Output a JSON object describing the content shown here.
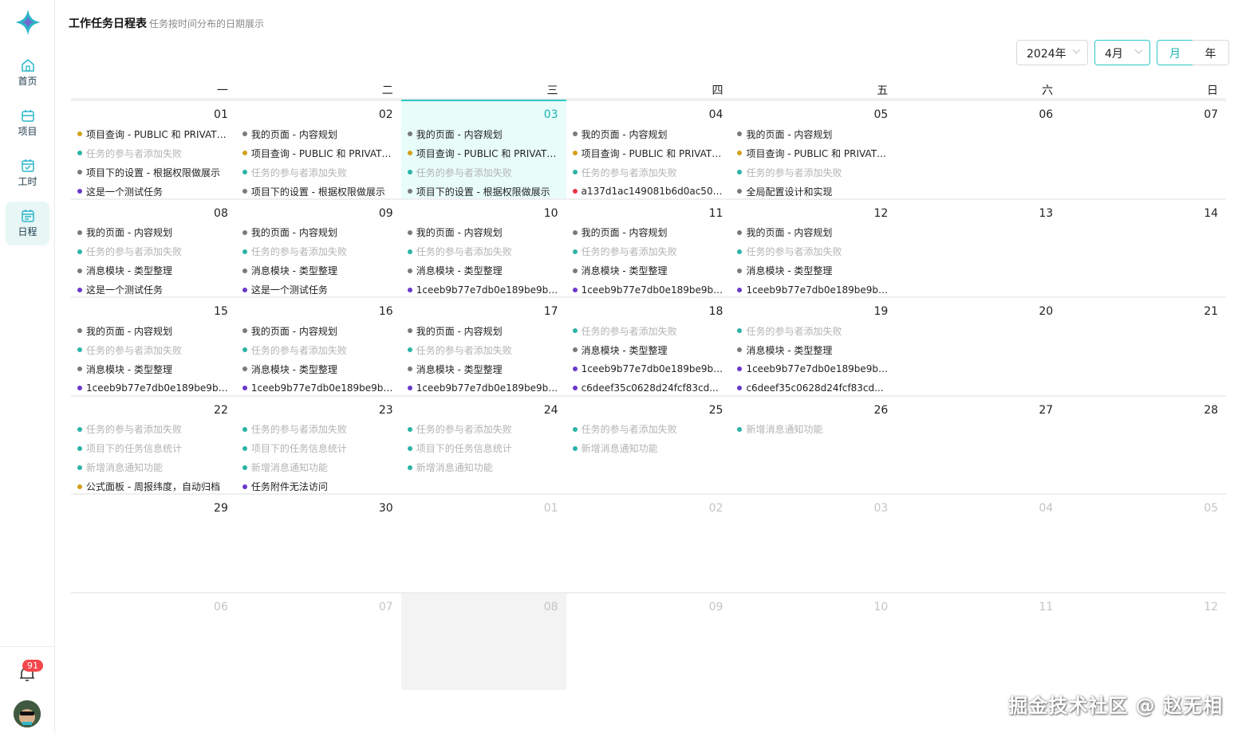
{
  "header": {
    "title": "工作任务日程表",
    "subtitle": "任务按时间分布的日期展示",
    "year": "2024年",
    "month": "4月",
    "view_month": "月",
    "view_year": "年"
  },
  "sidebar": {
    "items": [
      {
        "label": "首页"
      },
      {
        "label": "项目"
      },
      {
        "label": "工时"
      },
      {
        "label": "日程"
      }
    ],
    "notifications": "91"
  },
  "colors": {
    "accent": "#2cc5c5",
    "gray": "#7a7a7a",
    "teal": "#2bb3a8",
    "gold": "#d4a017",
    "purple": "#6a38c9",
    "red": "#e8363f"
  },
  "weekdays": [
    "一",
    "二",
    "三",
    "四",
    "五",
    "六",
    "日"
  ],
  "calendar": {
    "weeks": [
      {
        "days": [
          {
            "date": "01",
            "events": [
              {
                "c": "gold",
                "t": "项目查询 - PUBLIC 和 PRIVATE 项目查询"
              },
              {
                "c": "teal",
                "t": "任务的参与者添加失败",
                "dim": true
              },
              {
                "c": "gray",
                "t": "项目下的设置 - 根据权限做展示"
              },
              {
                "c": "purple",
                "t": "这是一个测试任务"
              }
            ]
          },
          {
            "date": "02",
            "events": [
              {
                "c": "gray",
                "t": "我的页面 - 内容规划"
              },
              {
                "c": "gold",
                "t": "项目查询 - PUBLIC 和 PRIVATE 项目查询"
              },
              {
                "c": "teal",
                "t": "任务的参与者添加失败",
                "dim": true
              },
              {
                "c": "gray",
                "t": "项目下的设置 - 根据权限做展示"
              }
            ]
          },
          {
            "date": "03",
            "today": true,
            "events": [
              {
                "c": "gray",
                "t": "我的页面 - 内容规划"
              },
              {
                "c": "gold",
                "t": "项目查询 - PUBLIC 和 PRIVATE 项目查询"
              },
              {
                "c": "teal",
                "t": "任务的参与者添加失败",
                "dim": true
              },
              {
                "c": "gray",
                "t": "项目下的设置 - 根据权限做展示"
              }
            ]
          },
          {
            "date": "04",
            "events": [
              {
                "c": "gray",
                "t": "我的页面 - 内容规划"
              },
              {
                "c": "gold",
                "t": "项目查询 - PUBLIC 和 PRIVATE 项目查询"
              },
              {
                "c": "teal",
                "t": "任务的参与者添加失败",
                "dim": true
              },
              {
                "c": "red",
                "t": "a137d1ac149081b6d0ac50d..."
              }
            ]
          },
          {
            "date": "05",
            "events": [
              {
                "c": "gray",
                "t": "我的页面 - 内容规划"
              },
              {
                "c": "gold",
                "t": "项目查询 - PUBLIC 和 PRIVATE 项目查询"
              },
              {
                "c": "teal",
                "t": "任务的参与者添加失败",
                "dim": true
              },
              {
                "c": "gray",
                "t": "全局配置设计和实现"
              }
            ]
          },
          {
            "date": "06",
            "events": []
          },
          {
            "date": "07",
            "events": []
          }
        ]
      },
      {
        "days": [
          {
            "date": "08",
            "events": [
              {
                "c": "gray",
                "t": "我的页面 - 内容规划"
              },
              {
                "c": "teal",
                "t": "任务的参与者添加失败",
                "dim": true
              },
              {
                "c": "gray",
                "t": "消息模块 - 类型整理"
              },
              {
                "c": "purple",
                "t": "这是一个测试任务"
              }
            ]
          },
          {
            "date": "09",
            "events": [
              {
                "c": "gray",
                "t": "我的页面 - 内容规划"
              },
              {
                "c": "teal",
                "t": "任务的参与者添加失败",
                "dim": true
              },
              {
                "c": "gray",
                "t": "消息模块 - 类型整理"
              },
              {
                "c": "purple",
                "t": "这是一个测试任务"
              }
            ]
          },
          {
            "date": "10",
            "events": [
              {
                "c": "gray",
                "t": "我的页面 - 内容规划"
              },
              {
                "c": "teal",
                "t": "任务的参与者添加失败",
                "dim": true
              },
              {
                "c": "gray",
                "t": "消息模块 - 类型整理"
              },
              {
                "c": "purple",
                "t": "1ceeb9b77e7db0e189be9bb..."
              }
            ]
          },
          {
            "date": "11",
            "events": [
              {
                "c": "gray",
                "t": "我的页面 - 内容规划"
              },
              {
                "c": "teal",
                "t": "任务的参与者添加失败",
                "dim": true
              },
              {
                "c": "gray",
                "t": "消息模块 - 类型整理"
              },
              {
                "c": "purple",
                "t": "1ceeb9b77e7db0e189be9bb..."
              }
            ]
          },
          {
            "date": "12",
            "events": [
              {
                "c": "gray",
                "t": "我的页面 - 内容规划"
              },
              {
                "c": "teal",
                "t": "任务的参与者添加失败",
                "dim": true
              },
              {
                "c": "gray",
                "t": "消息模块 - 类型整理"
              },
              {
                "c": "purple",
                "t": "1ceeb9b77e7db0e189be9bb..."
              }
            ]
          },
          {
            "date": "13",
            "events": []
          },
          {
            "date": "14",
            "events": []
          }
        ]
      },
      {
        "days": [
          {
            "date": "15",
            "events": [
              {
                "c": "gray",
                "t": "我的页面 - 内容规划"
              },
              {
                "c": "teal",
                "t": "任务的参与者添加失败",
                "dim": true
              },
              {
                "c": "gray",
                "t": "消息模块 - 类型整理"
              },
              {
                "c": "purple",
                "t": "1ceeb9b77e7db0e189be9bb..."
              }
            ]
          },
          {
            "date": "16",
            "events": [
              {
                "c": "gray",
                "t": "我的页面 - 内容规划"
              },
              {
                "c": "teal",
                "t": "任务的参与者添加失败",
                "dim": true
              },
              {
                "c": "gray",
                "t": "消息模块 - 类型整理"
              },
              {
                "c": "purple",
                "t": "1ceeb9b77e7db0e189be9bb..."
              }
            ]
          },
          {
            "date": "17",
            "events": [
              {
                "c": "gray",
                "t": "我的页面 - 内容规划"
              },
              {
                "c": "teal",
                "t": "任务的参与者添加失败",
                "dim": true
              },
              {
                "c": "gray",
                "t": "消息模块 - 类型整理"
              },
              {
                "c": "purple",
                "t": "1ceeb9b77e7db0e189be9bb..."
              }
            ]
          },
          {
            "date": "18",
            "events": [
              {
                "c": "teal",
                "t": "任务的参与者添加失败",
                "dim": true
              },
              {
                "c": "gray",
                "t": "消息模块 - 类型整理"
              },
              {
                "c": "purple",
                "t": "1ceeb9b77e7db0e189be9bb..."
              },
              {
                "c": "purple",
                "t": "c6deef35c0628d24fcf83cd..."
              }
            ]
          },
          {
            "date": "19",
            "events": [
              {
                "c": "teal",
                "t": "任务的参与者添加失败",
                "dim": true
              },
              {
                "c": "gray",
                "t": "消息模块 - 类型整理"
              },
              {
                "c": "purple",
                "t": "1ceeb9b77e7db0e189be9bb..."
              },
              {
                "c": "purple",
                "t": "c6deef35c0628d24fcf83cd..."
              }
            ]
          },
          {
            "date": "20",
            "events": []
          },
          {
            "date": "21",
            "events": []
          }
        ]
      },
      {
        "days": [
          {
            "date": "22",
            "events": [
              {
                "c": "teal",
                "t": "任务的参与者添加失败",
                "dim": true
              },
              {
                "c": "teal",
                "t": "项目下的任务信息统计",
                "dim": true
              },
              {
                "c": "teal",
                "t": "新增消息通知功能",
                "dim": true
              },
              {
                "c": "gold",
                "t": "公式面板 - 周报纬度，自动归档"
              }
            ]
          },
          {
            "date": "23",
            "events": [
              {
                "c": "teal",
                "t": "任务的参与者添加失败",
                "dim": true
              },
              {
                "c": "teal",
                "t": "项目下的任务信息统计",
                "dim": true
              },
              {
                "c": "teal",
                "t": "新增消息通知功能",
                "dim": true
              },
              {
                "c": "purple",
                "t": "任务附件无法访问"
              }
            ]
          },
          {
            "date": "24",
            "events": [
              {
                "c": "teal",
                "t": "任务的参与者添加失败",
                "dim": true
              },
              {
                "c": "teal",
                "t": "项目下的任务信息统计",
                "dim": true
              },
              {
                "c": "teal",
                "t": "新增消息通知功能",
                "dim": true
              }
            ]
          },
          {
            "date": "25",
            "events": [
              {
                "c": "teal",
                "t": "任务的参与者添加失败",
                "dim": true
              },
              {
                "c": "teal",
                "t": "新增消息通知功能",
                "dim": true
              }
            ]
          },
          {
            "date": "26",
            "events": [
              {
                "c": "teal",
                "t": "新增消息通知功能",
                "dim": true
              }
            ]
          },
          {
            "date": "27",
            "events": []
          },
          {
            "date": "28",
            "events": []
          }
        ]
      },
      {
        "days": [
          {
            "date": "29",
            "events": []
          },
          {
            "date": "30",
            "events": []
          },
          {
            "date": "01",
            "other": true,
            "events": []
          },
          {
            "date": "02",
            "other": true,
            "events": []
          },
          {
            "date": "03",
            "other": true,
            "events": []
          },
          {
            "date": "04",
            "other": true,
            "events": []
          },
          {
            "date": "05",
            "other": true,
            "events": []
          }
        ]
      },
      {
        "days": [
          {
            "date": "06",
            "other": true,
            "events": []
          },
          {
            "date": "07",
            "other": true,
            "events": []
          },
          {
            "date": "08",
            "other": true,
            "selected": true,
            "events": []
          },
          {
            "date": "09",
            "other": true,
            "events": []
          },
          {
            "date": "10",
            "other": true,
            "events": []
          },
          {
            "date": "11",
            "other": true,
            "events": []
          },
          {
            "date": "12",
            "other": true,
            "events": []
          }
        ]
      }
    ]
  },
  "watermark": "掘金技术社区 @ 赵无相"
}
